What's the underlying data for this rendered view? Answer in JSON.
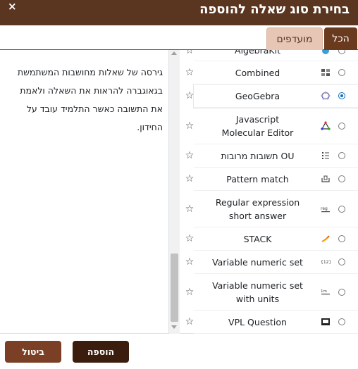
{
  "dialog": {
    "title": "בחירת סוג שאלה להוספה",
    "close_icon": "×"
  },
  "tabs": [
    {
      "label": "הכל",
      "active": true
    },
    {
      "label": "מועדפים",
      "active": false
    }
  ],
  "description": "גירסה של שאלות מחושבות המשתמשת בגאוגברה להראות את השאלה ולאמת את התשובה כאשר התלמיד עובד על החידון.",
  "list_items": [
    {
      "label": "AlgebraKit",
      "icon": "algebrakit-icon",
      "selected": false
    },
    {
      "label": "Combined",
      "icon": "combined-icon",
      "selected": false
    },
    {
      "label": "GeoGebra",
      "icon": "geogebra-icon",
      "selected": true
    },
    {
      "label": "Javascript\nMolecular Editor",
      "icon": "jme-icon",
      "selected": false
    },
    {
      "label": "OU תשובות מרובות",
      "icon": "multichoice-icon",
      "selected": false
    },
    {
      "label": "Pattern match",
      "icon": "pattern-match-icon",
      "selected": false
    },
    {
      "label": "Regular expression\nshort answer",
      "icon": "regexp-icon",
      "selected": false
    },
    {
      "label": "STACK",
      "icon": "stack-icon",
      "selected": false
    },
    {
      "label": "Variable numeric set",
      "icon": "varnumericset-icon",
      "selected": false
    },
    {
      "label": "Variable numeric set\nwith units",
      "icon": "varnumunit-icon",
      "selected": false
    },
    {
      "label": "VPL Question",
      "icon": "vpl-icon",
      "selected": false
    }
  ],
  "buttons": {
    "add": "הוספה",
    "cancel": "ביטול"
  },
  "colors": {
    "header": "#5a3520",
    "tab_active": "#6a3a1f",
    "tab_inactive": "#e7c6b6",
    "primary_button": "#3b1d0d",
    "secondary_button": "#7a3f24",
    "radio_selected": "#0f6cbf"
  }
}
